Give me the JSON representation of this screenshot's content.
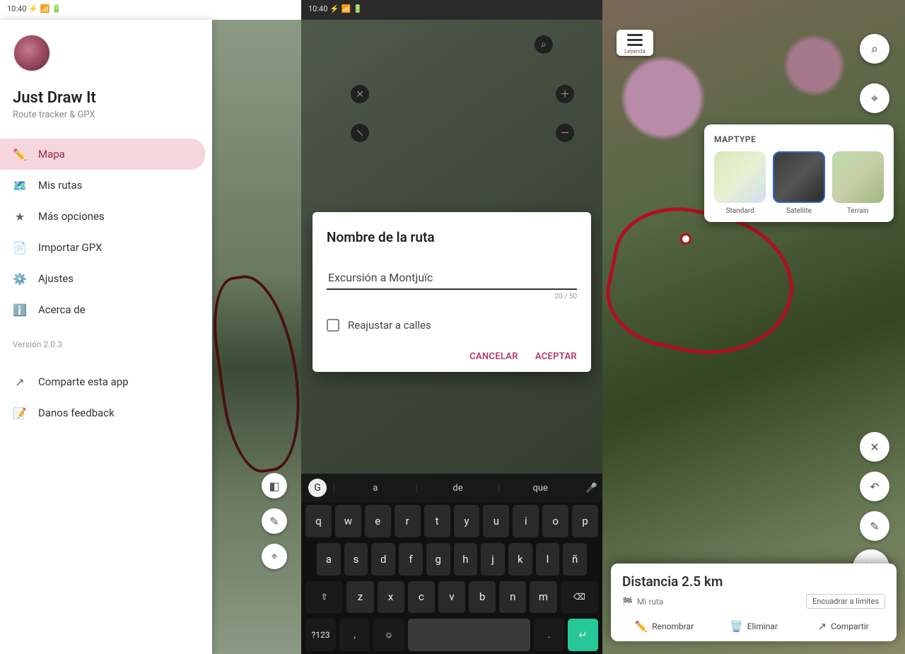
{
  "status_bar_left": "10:40  ⚡ 📶 🔋",
  "sidebar": {
    "app_title": "Just Draw It",
    "app_sub": "Route tracker & GPX",
    "items": [
      {
        "icon": "✏️",
        "label": "Mapa",
        "name": "nav-map",
        "active": true
      },
      {
        "icon": "🗺️",
        "label": "Mis rutas",
        "name": "nav-my-routes"
      },
      {
        "icon": "★",
        "label": "Más opciones",
        "name": "nav-more-options"
      },
      {
        "icon": "📄",
        "label": "Importar GPX",
        "name": "nav-import-gpx"
      },
      {
        "icon": "⚙️",
        "label": "Ajustes",
        "name": "nav-settings"
      },
      {
        "icon": "ℹ️",
        "label": "Acerca de",
        "name": "nav-about"
      }
    ],
    "version_label": "Versión 2.0.3",
    "footer": [
      {
        "icon": "↗",
        "label": "Comparte esta app",
        "name": "nav-share-app"
      },
      {
        "icon": "📝",
        "label": "Danos feedback",
        "name": "nav-feedback"
      }
    ]
  },
  "dialog": {
    "title": "Nombre de la ruta",
    "input_value": "Excursión a Montjuïc",
    "counter": "20 / 50",
    "checkbox_label": "Reajustar a calles",
    "cancel": "CANCELAR",
    "accept": "ACEPTAR"
  },
  "suggestions": {
    "chip": "G",
    "s1": "a",
    "s2": "de",
    "s3": "que"
  },
  "keyboard_rows": [
    [
      "q",
      "w",
      "e",
      "r",
      "t",
      "y",
      "u",
      "i",
      "o",
      "p"
    ],
    [
      "a",
      "s",
      "d",
      "f",
      "g",
      "h",
      "j",
      "k",
      "l",
      "ñ"
    ],
    [
      "⇧",
      "z",
      "x",
      "c",
      "v",
      "b",
      "n",
      "m",
      "⌫"
    ],
    [
      "?123",
      ",",
      "☺",
      " ",
      ".",
      "↵"
    ]
  ],
  "panel3": {
    "menu_label": "Leyenda",
    "layers_title": "MAPTYPE",
    "layers": [
      {
        "label": "Standard",
        "name": "layer-standard",
        "thumb": "thumb-standard"
      },
      {
        "label": "Satellite",
        "name": "layer-satellite",
        "thumb": "thumb-sat"
      },
      {
        "label": "Terrain",
        "name": "layer-terrain",
        "thumb": "thumb-terrain"
      }
    ],
    "distance_title": "Distancia 2.5 km",
    "route_name": "Mi ruta",
    "bounds_button": "Encuadrar a límites",
    "actions": [
      {
        "icon": "✏️",
        "label": "Renombrar",
        "name": "action-rename"
      },
      {
        "icon": "🗑️",
        "label": "Eliminar",
        "name": "action-delete"
      },
      {
        "icon": "↗",
        "label": "Compartir",
        "name": "action-share"
      }
    ]
  }
}
